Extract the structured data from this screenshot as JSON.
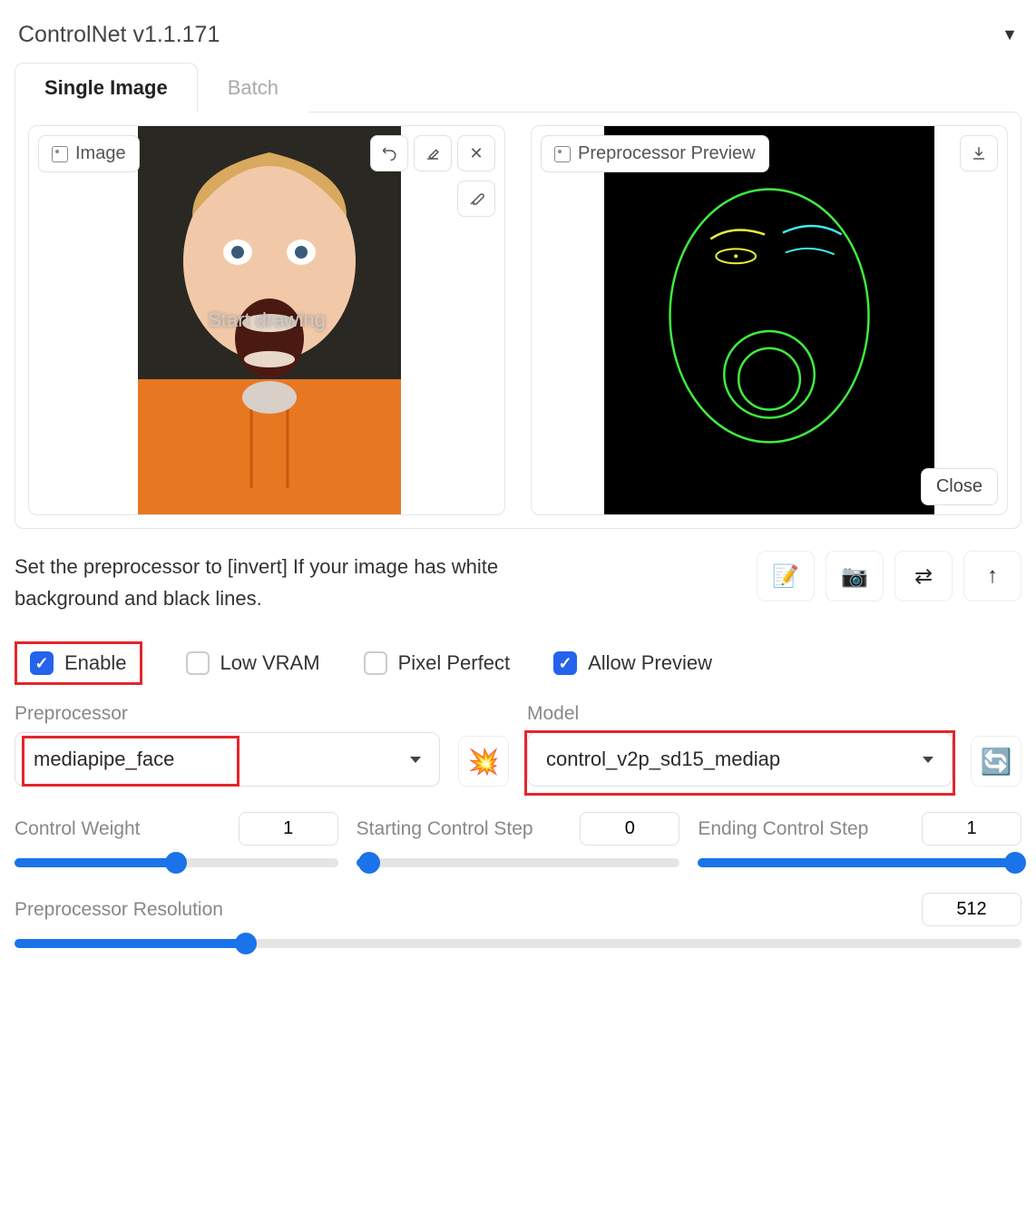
{
  "header": {
    "title": "ControlNet v1.1.171"
  },
  "tabs": {
    "single": "Single Image",
    "batch": "Batch",
    "active": 0
  },
  "image_panel": {
    "label": "Image",
    "overlay": "Start drawing"
  },
  "preview_panel": {
    "label": "Preprocessor Preview",
    "close": "Close"
  },
  "hint": "Set the preprocessor to [invert] If your image has white background and black lines.",
  "checkboxes": {
    "enable": {
      "label": "Enable",
      "checked": true
    },
    "low_vram": {
      "label": "Low VRAM",
      "checked": false
    },
    "pixel_perfect": {
      "label": "Pixel Perfect",
      "checked": false
    },
    "allow_preview": {
      "label": "Allow Preview",
      "checked": true
    }
  },
  "preprocessor": {
    "label": "Preprocessor",
    "value": "mediapipe_face"
  },
  "model": {
    "label": "Model",
    "value": "control_v2p_sd15_mediap"
  },
  "sliders": {
    "control_weight": {
      "label": "Control Weight",
      "value": "1",
      "fill_pct": 50
    },
    "start_step": {
      "label": "Starting Control Step",
      "value": "0",
      "fill_pct": 4
    },
    "end_step": {
      "label": "Ending Control Step",
      "value": "1",
      "fill_pct": 100
    },
    "resolution": {
      "label": "Preprocessor Resolution",
      "value": "512",
      "fill_pct": 23
    }
  },
  "icons": {
    "write": "📝",
    "camera": "📷",
    "swap": "⇄",
    "up": "↑",
    "run": "💥",
    "refresh": "🔄"
  }
}
